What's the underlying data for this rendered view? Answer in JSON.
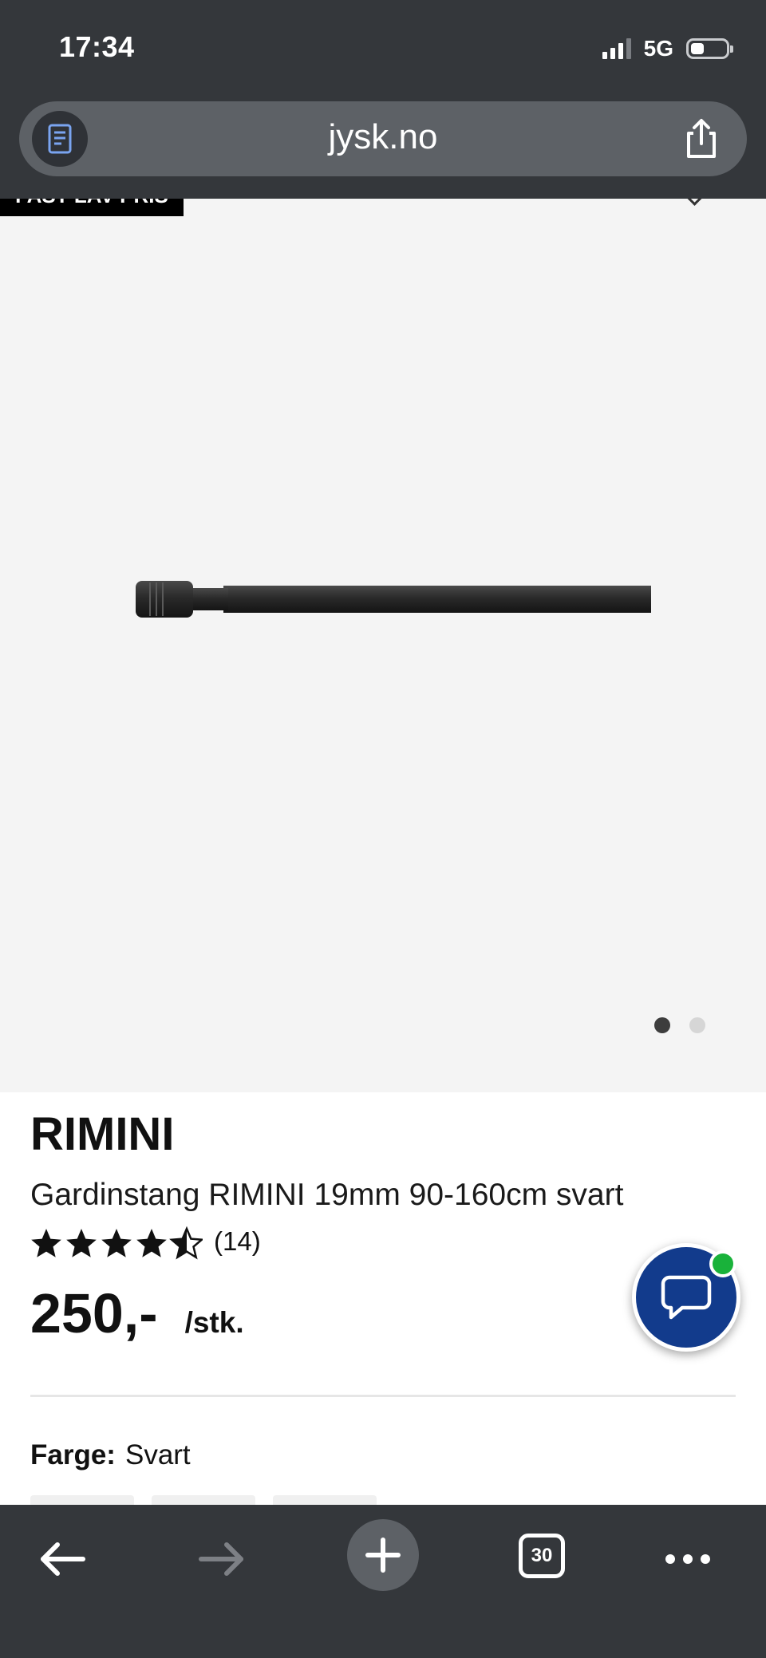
{
  "status_bar": {
    "time": "17:34",
    "network": "5G"
  },
  "browser": {
    "url": "jysk.no",
    "tab_count": "30"
  },
  "product": {
    "badge": "FAST LAV PRIS",
    "brand": "RIMINI",
    "title": "Gardinstang RIMINI 19mm 90-160cm svart",
    "rating": 4.5,
    "rating_count": "(14)",
    "price": "250,-",
    "price_unit": "/stk.",
    "color_label": "Farge:",
    "color_value": "Svart",
    "image_count": 2,
    "active_image": 1
  },
  "colors": {
    "chrome": "#34373b",
    "chat": "#123b8c",
    "online": "#19b23a"
  },
  "icons": [
    "reader-icon",
    "share-icon",
    "chat-icon",
    "back-arrow-icon",
    "forward-arrow-icon",
    "plus-icon",
    "tabs-icon",
    "more-icon"
  ]
}
